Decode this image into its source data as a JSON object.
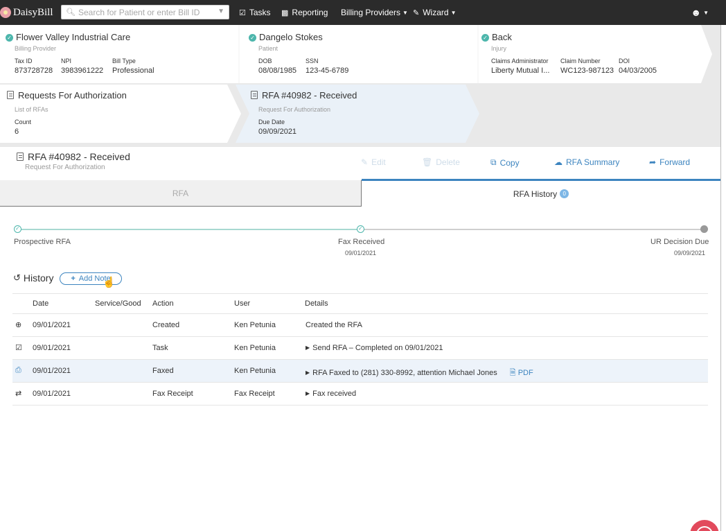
{
  "app": {
    "name": "DaisyBill"
  },
  "nav": {
    "search_placeholder": "Search for Patient or enter Bill ID",
    "tasks": "Tasks",
    "reporting": "Reporting",
    "billing_providers": "Billing Providers",
    "wizard": "Wizard"
  },
  "cards": {
    "provider": {
      "title": "Flower Valley Industrial Care",
      "sub": "Billing Provider",
      "tax_label": "Tax ID",
      "tax": "873728728",
      "npi_label": "NPI",
      "npi": "3983961222",
      "billtype_label": "Bill Type",
      "billtype": "Professional"
    },
    "patient": {
      "title": "Dangelo Stokes",
      "sub": "Patient",
      "dob_label": "DOB",
      "dob": "08/08/1985",
      "ssn_label": "SSN",
      "ssn": "123-45-6789"
    },
    "injury": {
      "title": "Back",
      "sub": "Injury",
      "admin_label": "Claims Administrator",
      "admin": "Liberty Mutual I...",
      "claim_label": "Claim Number",
      "claim": "WC123-987123",
      "doi_label": "DOI",
      "doi": "04/03/2005"
    },
    "rfa_list": {
      "title": "Requests For Authorization",
      "sub": "List of RFAs",
      "count_label": "Count",
      "count": "6"
    },
    "rfa_current": {
      "title": "RFA #40982 - Received",
      "sub": "Request For Authorization",
      "due_label": "Due Date",
      "due": "09/09/2021"
    }
  },
  "detail": {
    "title": "RFA #40982 - Received",
    "sub": "Request For Authorization",
    "actions": {
      "edit": "Edit",
      "delete": "Delete",
      "copy": "Copy",
      "summary": "RFA Summary",
      "forward": "Forward"
    }
  },
  "tabs": {
    "rfa": "RFA",
    "history": "RFA History",
    "history_badge": "0"
  },
  "timeline": {
    "steps": [
      {
        "label": "Prospective RFA",
        "date": "",
        "status": "done"
      },
      {
        "label": "Fax Received",
        "date": "09/01/2021",
        "status": "done"
      },
      {
        "label": "UR Decision Due",
        "date": "09/09/2021",
        "status": "pending"
      }
    ]
  },
  "history": {
    "title": "History",
    "add_note": "Add Note",
    "columns": [
      "Date",
      "Service/Good",
      "Action",
      "User",
      "Details"
    ],
    "rows": [
      {
        "icon": "plus-circle-icon",
        "date": "09/01/2021",
        "service": "",
        "action": "Created",
        "user": "Ken Petunia",
        "details": "Created the RFA"
      },
      {
        "icon": "task-icon",
        "date": "09/01/2021",
        "service": "",
        "action": "Task",
        "user": "Ken Petunia",
        "details": "Send RFA – Completed on 09/01/2021"
      },
      {
        "icon": "fax-icon",
        "date": "09/01/2021",
        "service": "",
        "action": "Faxed",
        "user": "Ken Petunia",
        "details": "RFA Faxed to (281) 330-8992, attention Michael Jones",
        "attachment": "PDF"
      },
      {
        "icon": "exchange-icon",
        "date": "09/01/2021",
        "service": "",
        "action": "Fax Receipt",
        "user": "Fax Receipt",
        "details": "Fax received"
      }
    ]
  },
  "colors": {
    "accent": "#3c84bf",
    "check": "#4db6ac",
    "nav_bg": "#2b2b2b",
    "highlight_row": "#edf3fa"
  }
}
